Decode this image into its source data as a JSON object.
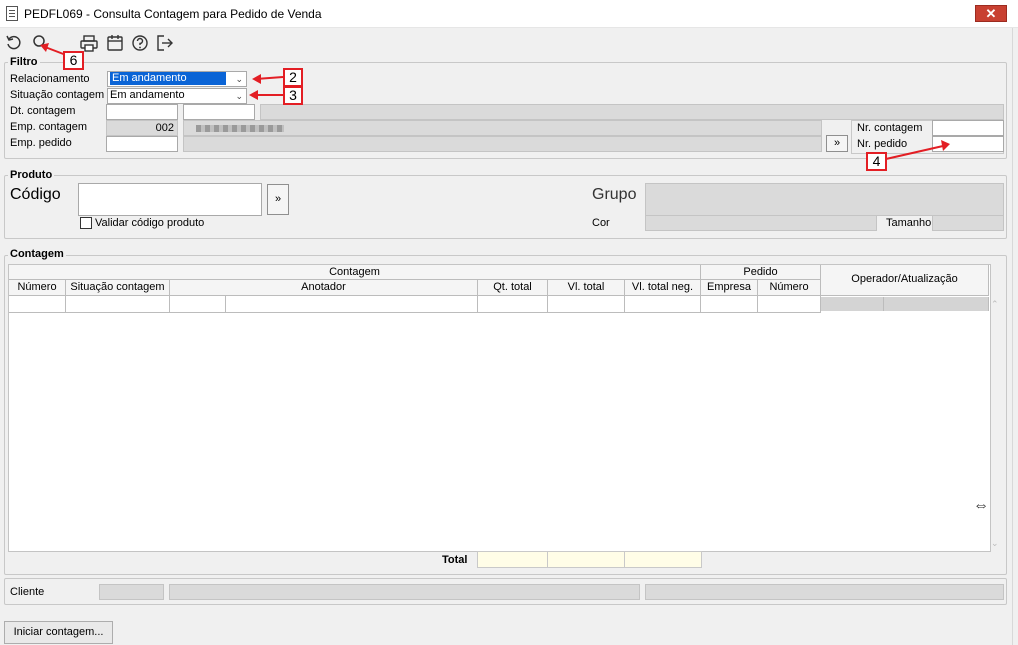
{
  "window": {
    "title": "PEDFL069 - Consulta Contagem para Pedido de Venda",
    "close_label": "✕"
  },
  "toolbar": {
    "items": [
      {
        "name": "refresh-icon"
      },
      {
        "name": "search-icon"
      },
      {
        "name": "print-icon"
      },
      {
        "name": "calendar-icon"
      },
      {
        "name": "help-icon"
      },
      {
        "name": "exit-icon"
      }
    ]
  },
  "filtro": {
    "title": "Filtro",
    "relacionamento_label": "Relacionamento",
    "relacionamento_value": "Em andamento",
    "situacao_label": "Situação contagem",
    "situacao_value": "Em andamento",
    "dt_contagem_label": "Dt. contagem",
    "emp_contagem_label": "Emp. contagem",
    "emp_contagem_value": "002",
    "emp_pedido_label": "Emp. pedido",
    "nr_contagem_label": "Nr. contagem",
    "nr_pedido_label": "Nr. pedido",
    "lookup_button": "»"
  },
  "produto": {
    "title": "Produto",
    "codigo_label": "Código",
    "lookup_button": "»",
    "validar_label": "Validar código produto",
    "grupo_label": "Grupo",
    "cor_label": "Cor",
    "tamanho_label": "Tamanho"
  },
  "contagem": {
    "title": "Contagem",
    "group_headers": {
      "contagem": "Contagem",
      "pedido": "Pedido",
      "operador": "Operador/Atualização"
    },
    "columns": [
      "Número",
      "Situação contagem",
      "Anotador",
      "Qt. total",
      "Vl. total",
      "Vl. total neg.",
      "Empresa",
      "Número"
    ],
    "total_label": "Total"
  },
  "cliente": {
    "label": "Cliente"
  },
  "footer": {
    "iniciar_button": "Iniciar contagem..."
  },
  "annotations": [
    "2",
    "3",
    "4",
    "6"
  ],
  "colors": {
    "annotation": "#e31e24",
    "selection": "#0a64d6",
    "close": "#c84031",
    "total_field": "#fffde7"
  }
}
